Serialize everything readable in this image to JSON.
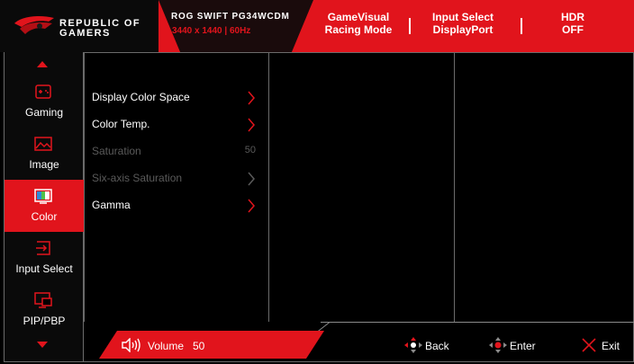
{
  "header": {
    "brand_line1": "REPUBLIC OF",
    "brand_line2": "GAMERS",
    "model_name": "ROG SWIFT PG34WCDM",
    "model_spec": "3440 x 1440  | 60Hz",
    "status": [
      {
        "line1": "GameVisual",
        "line2": "Racing Mode"
      },
      {
        "line1": "Input Select",
        "line2": "DisplayPort"
      },
      {
        "line1": "HDR",
        "line2": "OFF"
      }
    ]
  },
  "sidebar": {
    "items": [
      {
        "label": "Gaming",
        "icon": "gamepad-icon"
      },
      {
        "label": "Image",
        "icon": "image-icon"
      },
      {
        "label": "Color",
        "icon": "color-icon",
        "active": true
      },
      {
        "label": "Input Select",
        "icon": "input-icon"
      },
      {
        "label": "PIP/PBP",
        "icon": "pip-icon"
      }
    ]
  },
  "menu": {
    "items": [
      {
        "label": "Display Color Space",
        "enabled": true,
        "chevron": true
      },
      {
        "label": "Color Temp.",
        "enabled": true,
        "chevron": true
      },
      {
        "label": "Saturation",
        "enabled": false,
        "value": "50"
      },
      {
        "label": "Six-axis Saturation",
        "enabled": false,
        "chevron": true
      },
      {
        "label": "Gamma",
        "enabled": true,
        "chevron": true
      }
    ]
  },
  "footer": {
    "volume_label": "Volume",
    "volume_value": "50",
    "back_label": "Back",
    "enter_label": "Enter",
    "exit_label": "Exit"
  },
  "colors": {
    "accent": "#e1141c",
    "background": "#000000",
    "disabled_text": "#5a5a5a",
    "divider": "#6b6b6b"
  }
}
